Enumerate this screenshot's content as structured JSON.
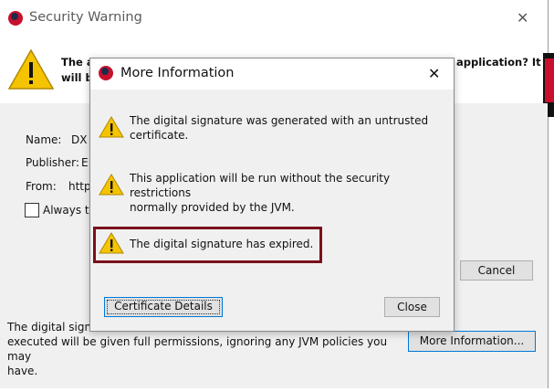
{
  "background_window": {
    "title": "Security Warning",
    "header_text_left_line1": "The a",
    "header_text_left_line2": "will b",
    "header_text_right": "application? It",
    "name_label": "Name:",
    "name_value": "DX",
    "publisher_label": "Publisher:",
    "publisher_value": "E",
    "from_label": "From:",
    "from_value": "http",
    "always_trust_label": "Always t",
    "cancel_label": "Cancel",
    "more_info_label": "More Information...",
    "bottom_line1": "The digital signa",
    "bottom_line2": "executed will be given full permissions, ignoring any JVM policies you may",
    "bottom_line3": "have."
  },
  "dialog": {
    "title": "More Information",
    "messages": [
      {
        "line1": "The digital signature was generated with an untrusted",
        "line2": "certificate.",
        "icon": "warning-icon"
      },
      {
        "line1": "This application will be run without the security restrictions",
        "line2": "normally provided by the JVM.",
        "icon": "warning-icon"
      },
      {
        "line1": "The digital signature has expired.",
        "icon": "warning-icon",
        "highlighted": true
      }
    ],
    "certificate_details_label": "Certificate Details",
    "close_label": "Close"
  },
  "colors": {
    "highlight_border": "#7a0f1c",
    "focus_border": "#0078d7",
    "warning_yellow": "#f5c400"
  }
}
